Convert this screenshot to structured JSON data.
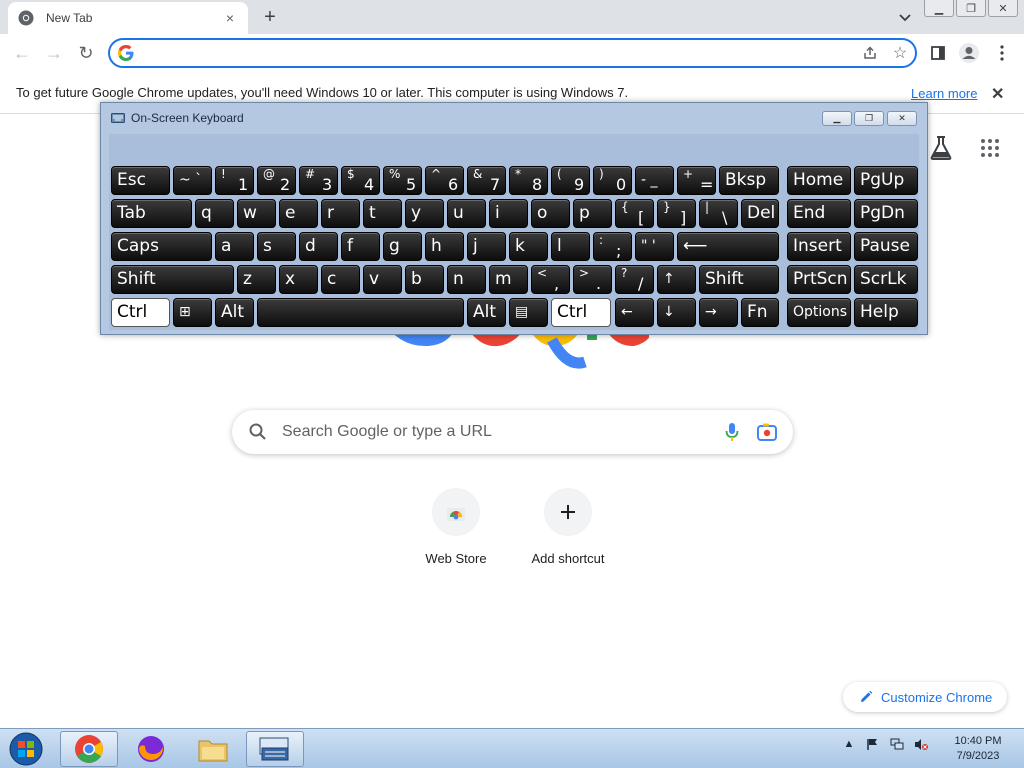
{
  "tab": {
    "title": "New Tab",
    "close": "×"
  },
  "toolbar": {
    "omnibox_value": ""
  },
  "infobar": {
    "text": "To get future Google Chrome updates, you'll need Windows 10 or later. This computer is using Windows 7.",
    "link": "Learn more",
    "close": "✕"
  },
  "ntp": {
    "search_placeholder": "Search Google or type a URL",
    "shortcuts": [
      {
        "label": "Web Store",
        "icon": "web-store-icon"
      },
      {
        "label": "Add shortcut",
        "icon": "plus-icon"
      }
    ],
    "customize_label": "Customize Chrome"
  },
  "osk": {
    "title": "On-Screen Keyboard",
    "keys": {
      "esc": "Esc",
      "tilde": "~ `",
      "k1_alt": "!",
      "k1": "1",
      "k2_alt": "@",
      "k2": "2",
      "k3_alt": "#",
      "k3": "3",
      "k4_alt": "$",
      "k4": "4",
      "k5_alt": "%",
      "k5": "5",
      "k6_alt": "^",
      "k6": "6",
      "k7_alt": "&",
      "k7": "7",
      "k8_alt": "*",
      "k8": "8",
      "k9_alt": "(",
      "k9": "9",
      "k0_alt": ")",
      "k0": "0",
      "minus": "- _",
      "plus_alt": "+",
      "equal": "=",
      "bksp": "Bksp",
      "home": "Home",
      "pgup": "PgUp",
      "tab": "Tab",
      "q": "q",
      "w": "w",
      "e": "e",
      "r": "r",
      "t": "t",
      "y": "y",
      "u": "u",
      "i": "i",
      "o": "o",
      "p": "p",
      "lbrace_alt": "{",
      "lbrace": "[",
      "rbrace_alt": "}",
      "rbrace": "]",
      "pipe_alt": "|",
      "backslash": "\\",
      "del": "Del",
      "end": "End",
      "pgdn": "PgDn",
      "caps": "Caps",
      "a": "a",
      "s": "s",
      "d": "d",
      "f": "f",
      "g": "g",
      "h": "h",
      "j": "j",
      "k": "k",
      "l": "l",
      "colon_alt": ":",
      "semicolon": ";",
      "quote": "\" '",
      "enter": "⟵",
      "insert": "Insert",
      "pause": "Pause",
      "shift": "Shift",
      "z": "z",
      "x": "x",
      "c": "c",
      "v": "v",
      "b": "b",
      "n": "n",
      "m": "m",
      "lt_alt": "<",
      "comma": ",",
      "gt_alt": ">",
      "period": ".",
      "q_alt": "?",
      "slash": "/",
      "up": "↑",
      "shift_r": "Shift",
      "prtscn": "PrtScn",
      "scrlk": "ScrLk",
      "ctrl": "Ctrl",
      "win": "⊞",
      "alt": "Alt",
      "space": "",
      "alt_r": "Alt",
      "menu": "▤",
      "ctrl_r": "Ctrl",
      "left": "←",
      "down": "↓",
      "right": "→",
      "fn": "Fn",
      "options": "Options",
      "help": "Help"
    }
  },
  "taskbar": {
    "apps": [
      "start-orb",
      "chrome",
      "firefox",
      "file-explorer",
      "on-screen-keyboard"
    ],
    "time": "10:40 PM",
    "date": "7/9/2023"
  },
  "colors": {
    "accent": "#1a73e8",
    "osk_bg": "#b5c8e2",
    "key_bg": "#1a1a1a"
  }
}
